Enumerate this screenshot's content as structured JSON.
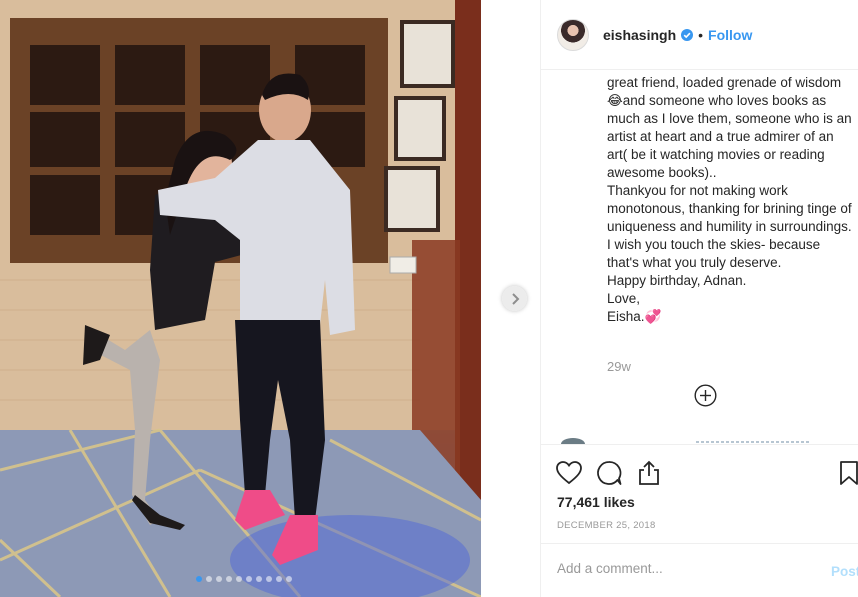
{
  "post": {
    "username": "eishasingh",
    "verified": true,
    "separator": "•",
    "follow_label": "Follow",
    "caption": [
      "great friend, loaded grenade of wisdom 😂and someone who loves books as much as I love them, someone who is an artist at heart and a true admirer of an art( be it watching movies or reading awesome books)..",
      "Thankyou for not making work monotonous, thanking for brining tinge of uniqueness and humility in surroundings. I wish you touch the skies- because that's what you truly deserve.",
      "Happy birthday, Adnan.",
      "Love,",
      "Eisha.💞"
    ],
    "time_ago": "29w",
    "likes": "77,461 likes",
    "date": "December 25, 2018",
    "comment_placeholder": "Add a comment...",
    "post_label": "Post"
  },
  "carousel": {
    "total": 10,
    "active": 0
  },
  "icons": {
    "verified": "verified-badge-icon",
    "next": "chevron-right-icon",
    "load_more": "plus-circle-icon",
    "like": "heart-icon",
    "comment": "speech-bubble-icon",
    "share": "share-icon",
    "save": "bookmark-icon"
  },
  "colors": {
    "accent": "#3897f0",
    "text": "#262626",
    "muted": "#999999",
    "border": "#efefef",
    "post_disabled": "#b2dffc"
  }
}
